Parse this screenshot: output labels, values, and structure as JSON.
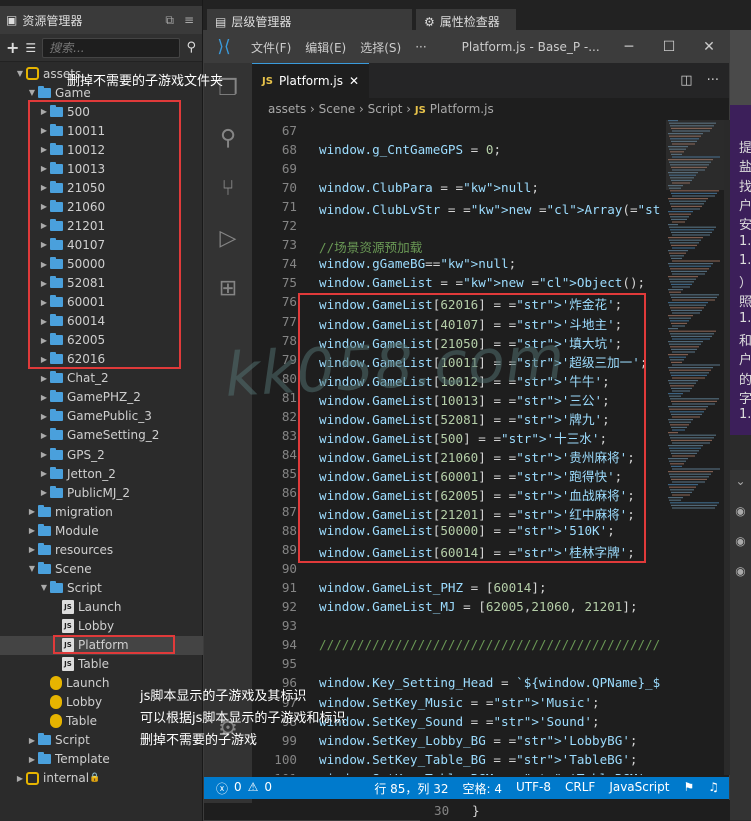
{
  "assets_panel": {
    "title": "资源管理器",
    "search_placeholder": "搜索...",
    "tree": [
      {
        "label": "assets",
        "depth": 0,
        "icon": "package-icon",
        "open": true
      },
      {
        "label": "Game",
        "depth": 1,
        "icon": "folder-icon",
        "open": true
      },
      {
        "label": "500",
        "depth": 2,
        "icon": "folder-icon"
      },
      {
        "label": "10011",
        "depth": 2,
        "icon": "folder-icon"
      },
      {
        "label": "10012",
        "depth": 2,
        "icon": "folder-icon"
      },
      {
        "label": "10013",
        "depth": 2,
        "icon": "folder-icon"
      },
      {
        "label": "21050",
        "depth": 2,
        "icon": "folder-icon"
      },
      {
        "label": "21060",
        "depth": 2,
        "icon": "folder-icon"
      },
      {
        "label": "21201",
        "depth": 2,
        "icon": "folder-icon"
      },
      {
        "label": "40107",
        "depth": 2,
        "icon": "folder-icon"
      },
      {
        "label": "50000",
        "depth": 2,
        "icon": "folder-icon"
      },
      {
        "label": "52081",
        "depth": 2,
        "icon": "folder-icon"
      },
      {
        "label": "60001",
        "depth": 2,
        "icon": "folder-icon"
      },
      {
        "label": "60014",
        "depth": 2,
        "icon": "folder-icon"
      },
      {
        "label": "62005",
        "depth": 2,
        "icon": "folder-icon"
      },
      {
        "label": "62016",
        "depth": 2,
        "icon": "folder-icon"
      },
      {
        "label": "Chat_2",
        "depth": 2,
        "icon": "folder-icon"
      },
      {
        "label": "GamePHZ_2",
        "depth": 2,
        "icon": "folder-icon"
      },
      {
        "label": "GamePublic_3",
        "depth": 2,
        "icon": "folder-icon"
      },
      {
        "label": "GameSetting_2",
        "depth": 2,
        "icon": "folder-icon"
      },
      {
        "label": "GPS_2",
        "depth": 2,
        "icon": "folder-icon"
      },
      {
        "label": "Jetton_2",
        "depth": 2,
        "icon": "folder-icon"
      },
      {
        "label": "PublicMJ_2",
        "depth": 2,
        "icon": "folder-icon"
      },
      {
        "label": "migration",
        "depth": 1,
        "icon": "folder-icon"
      },
      {
        "label": "Module",
        "depth": 1,
        "icon": "folder-icon"
      },
      {
        "label": "resources",
        "depth": 1,
        "icon": "folder-icon"
      },
      {
        "label": "Scene",
        "depth": 1,
        "icon": "folder-icon",
        "open": true
      },
      {
        "label": "Script",
        "depth": 2,
        "icon": "folder-icon",
        "open": true
      },
      {
        "label": "Launch",
        "depth": 3,
        "icon": "js-file-icon"
      },
      {
        "label": "Lobby",
        "depth": 3,
        "icon": "js-file-icon"
      },
      {
        "label": "Platform",
        "depth": 3,
        "icon": "js-file-icon",
        "selected": true
      },
      {
        "label": "Table",
        "depth": 3,
        "icon": "js-file-icon"
      },
      {
        "label": "Launch",
        "depth": 2,
        "icon": "scene-icon"
      },
      {
        "label": "Lobby",
        "depth": 2,
        "icon": "scene-icon"
      },
      {
        "label": "Table",
        "depth": 2,
        "icon": "scene-icon"
      },
      {
        "label": "Script",
        "depth": 1,
        "icon": "folder-icon"
      },
      {
        "label": "Template",
        "depth": 1,
        "icon": "folder-icon"
      },
      {
        "label": "internal",
        "depth": 0,
        "icon": "package-icon"
      }
    ]
  },
  "cocos_tabs": {
    "hierarchy": "层级管理器",
    "inspector": "属性检查器"
  },
  "vscode": {
    "menu": [
      "文件(F)",
      "编辑(E)",
      "选择(S)",
      "···"
    ],
    "title": "Platform.js - Base_P -...",
    "tab_label": "Platform.js",
    "tab_close": "✕",
    "breadcrumb": [
      "assets",
      "Scene",
      "Script",
      "Platform.js"
    ],
    "code": [
      {
        "n": "67",
        "t": ""
      },
      {
        "n": "68",
        "t": "window.g_CntGameGPS = 0;"
      },
      {
        "n": "69",
        "t": ""
      },
      {
        "n": "70",
        "t": "window.ClubPara = null;"
      },
      {
        "n": "71",
        "t": "window.ClubLvStr = new Array(\"路人\",\"黑名单\",\""
      },
      {
        "n": "72",
        "t": ""
      },
      {
        "n": "73",
        "t": "//场景资源预加载"
      },
      {
        "n": "74",
        "t": "window.gGameBG=null;"
      },
      {
        "n": "75",
        "t": "window.GameList = new Object();"
      },
      {
        "n": "76",
        "t": "window.GameList[62016] = '炸金花';"
      },
      {
        "n": "77",
        "t": "window.GameList[40107] = '斗地主';"
      },
      {
        "n": "78",
        "t": "window.GameList[21050] = '填大坑';"
      },
      {
        "n": "79",
        "t": "window.GameList[10011] = '超级三加一';"
      },
      {
        "n": "80",
        "t": "window.GameList[10012] = '牛牛';"
      },
      {
        "n": "81",
        "t": "window.GameList[10013] = '三公';"
      },
      {
        "n": "82",
        "t": "window.GameList[52081] = '牌九';"
      },
      {
        "n": "83",
        "t": "window.GameList[500] = '十三水';"
      },
      {
        "n": "84",
        "t": "window.GameList[21060] = '贵州麻将';"
      },
      {
        "n": "85",
        "t": "window.GameList[60001] = '跑得快';"
      },
      {
        "n": "86",
        "t": "window.GameList[62005] = '血战麻将';"
      },
      {
        "n": "87",
        "t": "window.GameList[21201] = '红中麻将';"
      },
      {
        "n": "88",
        "t": "window.GameList[50000] = '510K';"
      },
      {
        "n": "89",
        "t": "window.GameList[60014] = '桂林字牌';"
      },
      {
        "n": "90",
        "t": ""
      },
      {
        "n": "91",
        "t": "window.GameList_PHZ = [60014];"
      },
      {
        "n": "92",
        "t": "window.GameList_MJ = [62005,21060, 21201];"
      },
      {
        "n": "93",
        "t": ""
      },
      {
        "n": "94",
        "t": "/////////////////////////////////////////////"
      },
      {
        "n": "95",
        "t": ""
      },
      {
        "n": "96",
        "t": "window.Key_Setting_Head = `${window.QPName}_$"
      },
      {
        "n": "97",
        "t": "window.SetKey_Music = 'Music';"
      },
      {
        "n": "98",
        "t": "window.SetKey_Sound = 'Sound';"
      },
      {
        "n": "99",
        "t": "window.SetKey_Lobby_BG = 'LobbyBG';"
      },
      {
        "n": "100",
        "t": "window.SetKey_Table_BG = 'TableBG';"
      },
      {
        "n": "101",
        "t": "window.SetKey_Table_BGM = 'TableBGM';"
      }
    ],
    "status": {
      "errors": "0",
      "warnings": "0",
      "position": "行 85，列 32",
      "spaces": "空格: 4",
      "encoding": "UTF-8",
      "eol": "CRLF",
      "language": "JavaScript"
    }
  },
  "annotations": {
    "top": "删掉不需要的子游戏文件夹",
    "bottom": [
      "js脚本显示的子游戏及其标识",
      "可以根据js脚本显示的子游戏和标识",
      "删掉不需要的子游戏"
    ]
  },
  "right_fragments": [
    "提",
    "盐",
    "找",
    "户",
    "安",
    "1.",
    "1.",
    "）",
    "照",
    "1.",
    "和",
    "户",
    "的",
    "字",
    "1."
  ],
  "bottom_line": {
    "n": "30",
    "t": "}"
  },
  "watermark": "kk058.com"
}
